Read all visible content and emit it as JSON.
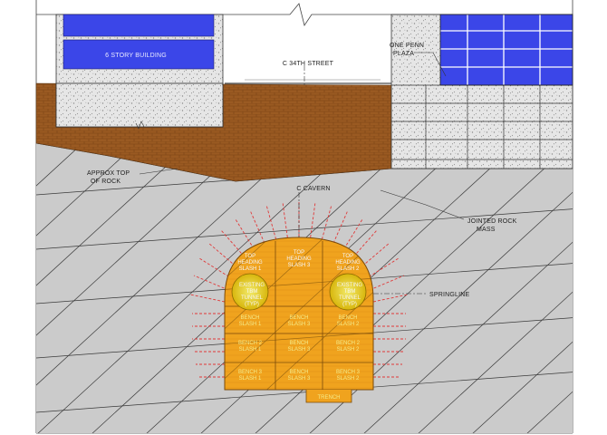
{
  "labels": {
    "building": "6 STORY BUILDING",
    "street": "C 34TH STREET",
    "one_penn_line1": "ONE PENN",
    "one_penn_line2": "PLAZA",
    "rock_top_line1": "APPROX TOP",
    "rock_top_line2": "OF ROCK",
    "cavern": "C CAVERN",
    "jointed_line1": "JOINTED ROCK",
    "jointed_line2": "MASS",
    "springline": "SPRINGLINE",
    "bench": "BENCH",
    "trench": "TRENCH"
  },
  "top_headings": [
    {
      "line1": "TOP",
      "line2": "HEADING",
      "line3": "SLASH 1"
    },
    {
      "line1": "TOP",
      "line2": "HEADING",
      "line3": "SLASH 3"
    },
    {
      "line1": "TOP",
      "line2": "HEADING",
      "line3": "SLASH 2"
    }
  ],
  "tbm_tunnels": [
    {
      "line1": "EXISTING",
      "line2": "TBM",
      "line3": "TUNNEL",
      "line4": "(TYP)"
    },
    {
      "line1": "EXISTING",
      "line2": "TBM",
      "line3": "TUNNEL",
      "line4": "(TYP)"
    }
  ],
  "bench_rows": [
    [
      {
        "line1": "BENCH",
        "line2": "SLASH 1"
      },
      {
        "line1": "BENCH",
        "line2": "SLASH 3"
      },
      {
        "line1": "BENCH",
        "line2": "SLASH 2"
      }
    ],
    [
      {
        "line1": "BENCH 2",
        "line2": "SLASH 1"
      },
      {
        "line1": "BENCH",
        "line2": "SLASH 3"
      },
      {
        "line1": "BENCH 2",
        "line2": "SLASH 2"
      }
    ],
    [
      {
        "line1": "BENCH 3",
        "line2": "SLASH 1"
      },
      {
        "line1": "BENCH",
        "line2": "SLASH 3"
      },
      {
        "line1": "BENCH 3",
        "line2": "SLASH 2"
      }
    ]
  ],
  "colors": {
    "rock": "#cbcbcb",
    "soil": "#9a5a22",
    "cavern": "#f0a31e",
    "bolt": "#e03a3a",
    "glass": "#3b46e8",
    "tbm": "#e8dc18"
  }
}
